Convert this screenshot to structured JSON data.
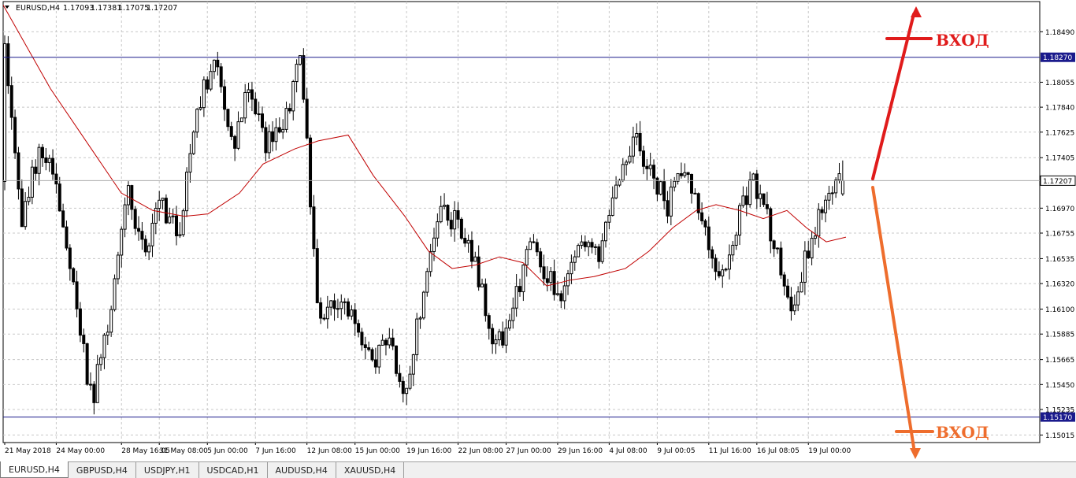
{
  "chart_data": {
    "type": "candlestick",
    "header": {
      "symbol": "EURUSD,H4",
      "open": "1.17093",
      "high": "1.17381",
      "low": "1.17075",
      "close": "1.17207"
    },
    "ylim": [
      1.1495,
      1.1875
    ],
    "y_ticks": [
      "1.18490",
      "1.18055",
      "1.17840",
      "1.17625",
      "1.17405",
      "1.16970",
      "1.16755",
      "1.16535",
      "1.16320",
      "1.16100",
      "1.15885",
      "1.15665",
      "1.15450",
      "1.15235",
      "1.15015"
    ],
    "x_ticks": [
      "21 May 2018",
      "24 May 00:00",
      "28 May 16:05",
      "31 May 08:00",
      "5 Jun 00:00",
      "7 Jun 16:00",
      "12 Jun 08:00",
      "15 Jun 00:00",
      "19 Jun 16:00",
      "22 Jun 08:00",
      "27 Jun 00:00",
      "29 Jun 16:00",
      "4 Jul 08:00",
      "9 Jul 00:05",
      "11 Jul 16:00",
      "16 Jul 08:05",
      "19 Jul 00:00"
    ],
    "horizontal_lines": [
      {
        "price": "1.18270",
        "color": "#1a1a8c"
      },
      {
        "price": "1.15170",
        "color": "#1a1a8c"
      }
    ],
    "current_price": "1.17207",
    "grid": true,
    "waypoints": [
      [
        1.172,
        1.186,
        1.17,
        1.183
      ],
      [
        1.183,
        1.183,
        1.165,
        1.1685
      ],
      [
        1.1685,
        1.177,
        1.166,
        1.175
      ],
      [
        1.175,
        1.177,
        1.168,
        1.172
      ],
      [
        1.172,
        1.173,
        1.16,
        1.162
      ],
      [
        1.162,
        1.1625,
        1.151,
        1.153
      ],
      [
        1.153,
        1.161,
        1.152,
        1.16
      ],
      [
        1.16,
        1.172,
        1.159,
        1.171
      ],
      [
        1.171,
        1.172,
        1.164,
        1.166
      ],
      [
        1.166,
        1.172,
        1.164,
        1.17
      ],
      [
        1.17,
        1.173,
        1.1655,
        1.168
      ],
      [
        1.168,
        1.179,
        1.167,
        1.178
      ],
      [
        1.178,
        1.1845,
        1.177,
        1.1825
      ],
      [
        1.1825,
        1.1835,
        1.173,
        1.175
      ],
      [
        1.175,
        1.1815,
        1.174,
        1.18
      ],
      [
        1.18,
        1.181,
        1.174,
        1.175
      ],
      [
        1.175,
        1.179,
        1.174,
        1.1775
      ],
      [
        1.1775,
        1.1845,
        1.176,
        1.1825
      ],
      [
        1.1825,
        1.1828,
        1.157,
        1.159
      ],
      [
        1.159,
        1.164,
        1.1545,
        1.162
      ],
      [
        1.162,
        1.163,
        1.156,
        1.16
      ],
      [
        1.16,
        1.164,
        1.153,
        1.156
      ],
      [
        1.156,
        1.161,
        1.154,
        1.159
      ],
      [
        1.159,
        1.1595,
        1.152,
        1.153
      ],
      [
        1.153,
        1.165,
        1.152,
        1.163
      ],
      [
        1.163,
        1.172,
        1.162,
        1.17
      ],
      [
        1.17,
        1.172,
        1.166,
        1.168
      ],
      [
        1.168,
        1.169,
        1.162,
        1.165
      ],
      [
        1.165,
        1.1655,
        1.1545,
        1.157
      ],
      [
        1.157,
        1.162,
        1.154,
        1.16
      ],
      [
        1.16,
        1.169,
        1.159,
        1.167
      ],
      [
        1.167,
        1.168,
        1.163,
        1.164
      ],
      [
        1.164,
        1.166,
        1.16,
        1.162
      ],
      [
        1.162,
        1.169,
        1.161,
        1.167
      ],
      [
        1.167,
        1.168,
        1.164,
        1.1655
      ],
      [
        1.1655,
        1.174,
        1.165,
        1.172
      ],
      [
        1.172,
        1.1785,
        1.171,
        1.176
      ],
      [
        1.176,
        1.177,
        1.17,
        1.1725
      ],
      [
        1.1725,
        1.174,
        1.169,
        1.17
      ],
      [
        1.17,
        1.1745,
        1.169,
        1.173
      ],
      [
        1.173,
        1.1735,
        1.166,
        1.168
      ],
      [
        1.168,
        1.169,
        1.161,
        1.163
      ],
      [
        1.163,
        1.17,
        1.162,
        1.169
      ],
      [
        1.169,
        1.174,
        1.168,
        1.172
      ],
      [
        1.172,
        1.1735,
        1.165,
        1.167
      ],
      [
        1.167,
        1.1675,
        1.158,
        1.16
      ],
      [
        1.16,
        1.168,
        1.1595,
        1.166
      ],
      [
        1.166,
        1.172,
        1.163,
        1.17
      ],
      [
        1.17,
        1.1738,
        1.169,
        1.1721
      ]
    ],
    "moving_average": [
      [
        0,
        1.1872
      ],
      [
        60,
        1.18
      ],
      [
        120,
        1.174
      ],
      [
        150,
        1.171
      ],
      [
        190,
        1.1695
      ],
      [
        230,
        1.169
      ],
      [
        260,
        1.1692
      ],
      [
        300,
        1.171
      ],
      [
        330,
        1.1735
      ],
      [
        370,
        1.1748
      ],
      [
        400,
        1.1755
      ],
      [
        438,
        1.176
      ],
      [
        470,
        1.1725
      ],
      [
        510,
        1.169
      ],
      [
        540,
        1.166
      ],
      [
        570,
        1.1645
      ],
      [
        600,
        1.1648
      ],
      [
        630,
        1.1655
      ],
      [
        660,
        1.165
      ],
      [
        690,
        1.163
      ],
      [
        720,
        1.1635
      ],
      [
        750,
        1.1638
      ],
      [
        790,
        1.1645
      ],
      [
        820,
        1.166
      ],
      [
        850,
        1.168
      ],
      [
        880,
        1.1695
      ],
      [
        905,
        1.17
      ],
      [
        935,
        1.1695
      ],
      [
        965,
        1.1688
      ],
      [
        995,
        1.1695
      ],
      [
        1020,
        1.168
      ],
      [
        1045,
        1.1668
      ],
      [
        1070,
        1.1672
      ]
    ],
    "annotations": [
      {
        "text": "ВХОД",
        "color": "#e01b1b",
        "direction": "up"
      },
      {
        "text": "ВХОД",
        "color": "#ee6d2d",
        "direction": "down"
      }
    ]
  },
  "tabs": [
    {
      "label": "EURUSD,H4",
      "active": true
    },
    {
      "label": "GBPUSD,H4",
      "active": false
    },
    {
      "label": "USDJPY,H1",
      "active": false
    },
    {
      "label": "USDCAD,H1",
      "active": false
    },
    {
      "label": "AUDUSD,H4",
      "active": false
    },
    {
      "label": "XAUUSD,H4",
      "active": false
    }
  ]
}
